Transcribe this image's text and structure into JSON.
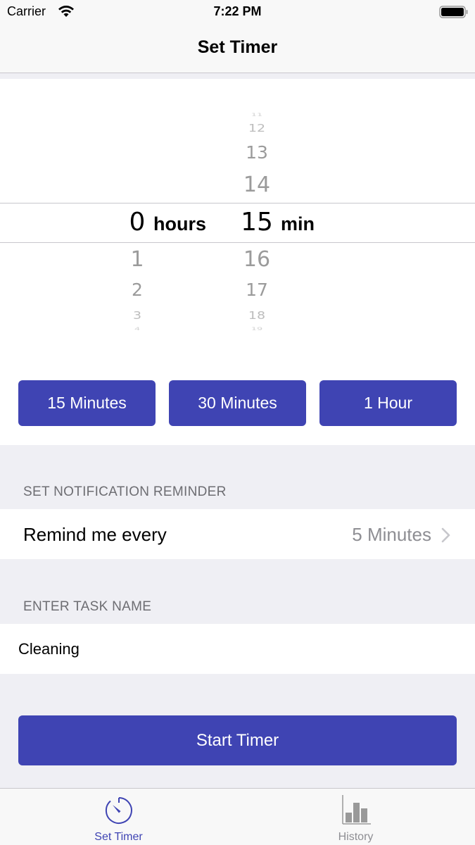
{
  "status_bar": {
    "carrier": "Carrier",
    "time": "7:22 PM",
    "wifi_icon": "wifi-icon",
    "battery_icon": "battery-full-icon"
  },
  "nav": {
    "title": "Set Timer"
  },
  "picker": {
    "hours": {
      "selected": "0",
      "unit": "hours",
      "below": [
        "1",
        "2",
        "3",
        "4"
      ]
    },
    "minutes": {
      "selected": "15",
      "unit": "min",
      "above": [
        "11",
        "12",
        "13",
        "14"
      ],
      "below": [
        "16",
        "17",
        "18",
        "19"
      ]
    }
  },
  "presets": [
    {
      "label": "15 Minutes"
    },
    {
      "label": "30 Minutes"
    },
    {
      "label": "1 Hour"
    }
  ],
  "reminder": {
    "header": "SET NOTIFICATION REMINDER",
    "label": "Remind me every",
    "value": "5 Minutes",
    "chevron_icon": "chevron-right-icon"
  },
  "task": {
    "header": "ENTER TASK NAME",
    "value": "Cleaning"
  },
  "start_button": {
    "label": "Start Timer"
  },
  "tabs": [
    {
      "label": "Set Timer",
      "icon": "timer-icon",
      "active": true
    },
    {
      "label": "History",
      "icon": "bar-chart-icon",
      "active": false
    }
  ],
  "colors": {
    "accent": "#3f44b3",
    "background": "#efeff4",
    "secondary_text": "#8e8e93",
    "inactive_tab": "#8e8e93"
  }
}
